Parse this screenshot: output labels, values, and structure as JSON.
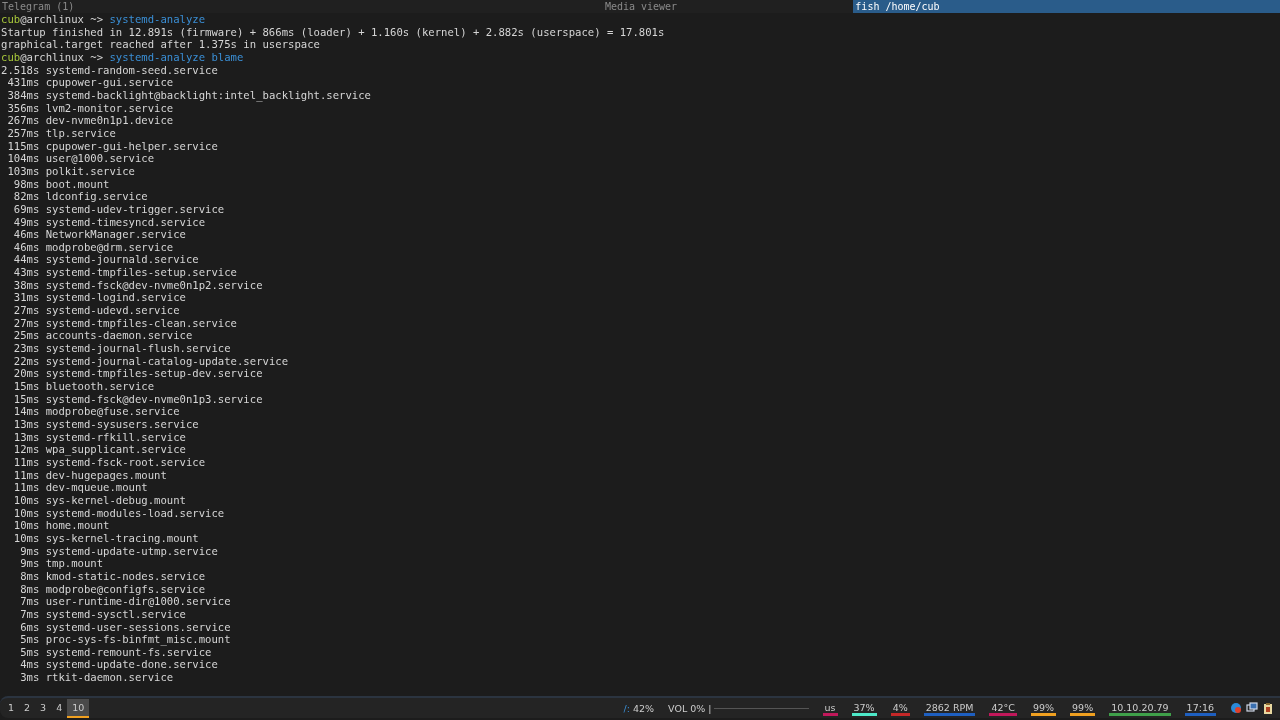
{
  "window_tabs": [
    {
      "title": "Telegram (1)",
      "selected": false
    },
    {
      "title": "Media viewer",
      "selected": false
    },
    {
      "title": "fish /home/cub",
      "selected": true
    }
  ],
  "terminal": {
    "lines": [
      {
        "kind": "prompt",
        "user": "cub",
        "host": "@archlinux ~> ",
        "command": "systemd-analyze"
      },
      {
        "kind": "output",
        "text": "Startup finished in 12.891s (firmware) + 866ms (loader) + 1.160s (kernel) + 2.882s (userspace) = 17.801s"
      },
      {
        "kind": "output",
        "text": "graphical.target reached after 1.375s in userspace"
      },
      {
        "kind": "prompt",
        "user": "cub",
        "host": "@archlinux ~> ",
        "command": "systemd-analyze blame"
      }
    ],
    "blame": [
      {
        "time": "2.518s",
        "unit": "systemd-random-seed.service"
      },
      {
        "time": "431ms",
        "unit": "cpupower-gui.service"
      },
      {
        "time": "384ms",
        "unit": "systemd-backlight@backlight:intel_backlight.service"
      },
      {
        "time": "356ms",
        "unit": "lvm2-monitor.service"
      },
      {
        "time": "267ms",
        "unit": "dev-nvme0n1p1.device"
      },
      {
        "time": "257ms",
        "unit": "tlp.service"
      },
      {
        "time": "115ms",
        "unit": "cpupower-gui-helper.service"
      },
      {
        "time": "104ms",
        "unit": "user@1000.service"
      },
      {
        "time": "103ms",
        "unit": "polkit.service"
      },
      {
        "time": "98ms",
        "unit": "boot.mount"
      },
      {
        "time": "82ms",
        "unit": "ldconfig.service"
      },
      {
        "time": "69ms",
        "unit": "systemd-udev-trigger.service"
      },
      {
        "time": "49ms",
        "unit": "systemd-timesyncd.service"
      },
      {
        "time": "46ms",
        "unit": "NetworkManager.service"
      },
      {
        "time": "46ms",
        "unit": "modprobe@drm.service"
      },
      {
        "time": "44ms",
        "unit": "systemd-journald.service"
      },
      {
        "time": "43ms",
        "unit": "systemd-tmpfiles-setup.service"
      },
      {
        "time": "38ms",
        "unit": "systemd-fsck@dev-nvme0n1p2.service"
      },
      {
        "time": "31ms",
        "unit": "systemd-logind.service"
      },
      {
        "time": "27ms",
        "unit": "systemd-udevd.service"
      },
      {
        "time": "27ms",
        "unit": "systemd-tmpfiles-clean.service"
      },
      {
        "time": "25ms",
        "unit": "accounts-daemon.service"
      },
      {
        "time": "23ms",
        "unit": "systemd-journal-flush.service"
      },
      {
        "time": "22ms",
        "unit": "systemd-journal-catalog-update.service"
      },
      {
        "time": "20ms",
        "unit": "systemd-tmpfiles-setup-dev.service"
      },
      {
        "time": "15ms",
        "unit": "bluetooth.service"
      },
      {
        "time": "15ms",
        "unit": "systemd-fsck@dev-nvme0n1p3.service"
      },
      {
        "time": "14ms",
        "unit": "modprobe@fuse.service"
      },
      {
        "time": "13ms",
        "unit": "systemd-sysusers.service"
      },
      {
        "time": "13ms",
        "unit": "systemd-rfkill.service"
      },
      {
        "time": "12ms",
        "unit": "wpa_supplicant.service"
      },
      {
        "time": "11ms",
        "unit": "systemd-fsck-root.service"
      },
      {
        "time": "11ms",
        "unit": "dev-hugepages.mount"
      },
      {
        "time": "11ms",
        "unit": "dev-mqueue.mount"
      },
      {
        "time": "10ms",
        "unit": "sys-kernel-debug.mount"
      },
      {
        "time": "10ms",
        "unit": "systemd-modules-load.service"
      },
      {
        "time": "10ms",
        "unit": "home.mount"
      },
      {
        "time": "10ms",
        "unit": "sys-kernel-tracing.mount"
      },
      {
        "time": "9ms",
        "unit": "systemd-update-utmp.service"
      },
      {
        "time": "9ms",
        "unit": "tmp.mount"
      },
      {
        "time": "8ms",
        "unit": "kmod-static-nodes.service"
      },
      {
        "time": "8ms",
        "unit": "modprobe@configfs.service"
      },
      {
        "time": "7ms",
        "unit": "user-runtime-dir@1000.service"
      },
      {
        "time": "7ms",
        "unit": "systemd-sysctl.service"
      },
      {
        "time": "6ms",
        "unit": "systemd-user-sessions.service"
      },
      {
        "time": "5ms",
        "unit": "proc-sys-fs-binfmt_misc.mount"
      },
      {
        "time": "5ms",
        "unit": "systemd-remount-fs.service"
      },
      {
        "time": "4ms",
        "unit": "systemd-update-done.service"
      },
      {
        "time": "3ms",
        "unit": "rtkit-daemon.service"
      }
    ]
  },
  "status_bar": {
    "workspaces": [
      {
        "label": "1",
        "selected": false
      },
      {
        "label": "2",
        "selected": false
      },
      {
        "label": "3",
        "selected": false
      },
      {
        "label": "4",
        "selected": false
      },
      {
        "label": "10",
        "selected": true
      }
    ],
    "disk": {
      "icon": "/:",
      "value": "42%"
    },
    "volume": {
      "label": "VOL 0% |",
      "level": 0
    },
    "indicators": [
      {
        "text": "us",
        "color": "#c2185b"
      },
      {
        "text": "37%",
        "color": "#4de8c8"
      },
      {
        "text": "4%",
        "color": "#c62828"
      },
      {
        "text": "2862 RPM",
        "color": "#1e5fc0"
      },
      {
        "text": "42°C",
        "color": "#c2185b"
      },
      {
        "text": "99%",
        "color": "#f0a020"
      },
      {
        "text": "99%",
        "color": "#f0a020"
      },
      {
        "text": "10.10.20.79",
        "color": "#3fa04a"
      },
      {
        "text": "17:16",
        "color": "#1e5fc0"
      }
    ]
  }
}
